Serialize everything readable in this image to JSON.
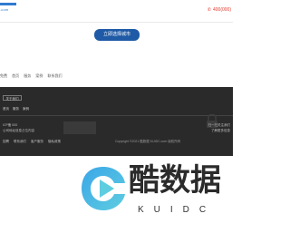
{
  "header": {
    "logo_text": ".com",
    "phone": "400(000)",
    "brand_color": "#2f7bd1",
    "phone_color": "#e5392c"
  },
  "cta": {
    "label": "立即选择城市",
    "color": "#1f5aa6"
  },
  "links": [
    "免费",
    "首页",
    "服务",
    "案例",
    "联系我们"
  ],
  "footer": {
    "tag": "关于我们",
    "categories": [
      "首页",
      "服务",
      "案例"
    ],
    "line1": "ICP备 000",
    "line2": "公司地址信息占位内容",
    "nav": [
      "招聘",
      "联系我们",
      "客户服务",
      "隐私政策"
    ],
    "copyright": "Copyright ©2021 酷数据 KUIDC.com 版权所有",
    "right1": "扫一扫关注我们",
    "right2": "了解更多信息",
    "bg": "#2a2a2a"
  },
  "brand": {
    "cn": "酷数据",
    "en": "KUIDC",
    "mark_colors": [
      "#3aa6e8",
      "#5ecde0"
    ]
  }
}
